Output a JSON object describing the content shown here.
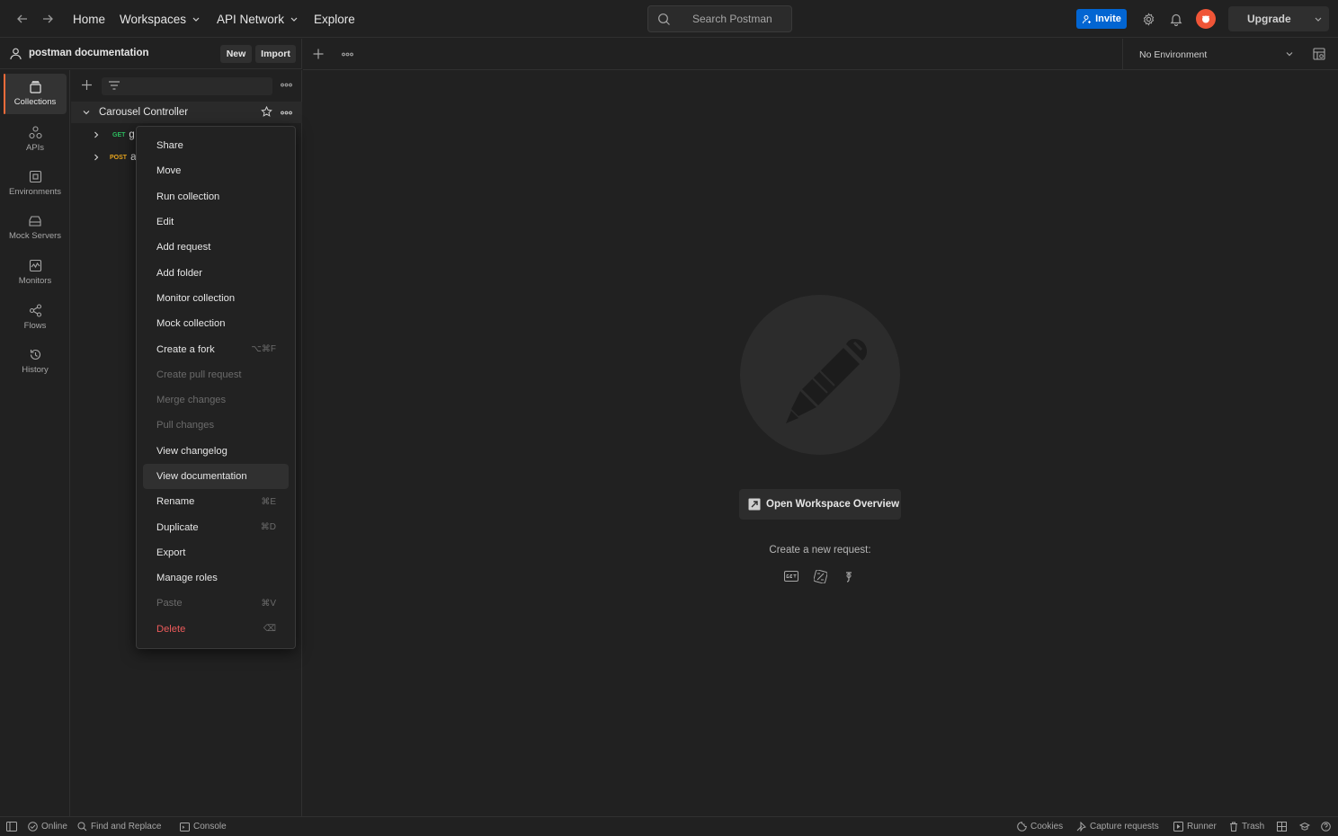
{
  "topbar": {
    "nav": {
      "home": "Home",
      "workspaces": "Workspaces",
      "api_network": "API Network",
      "explore": "Explore"
    },
    "search_placeholder": "Search Postman",
    "invite_label": "Invite",
    "upgrade_label": "Upgrade"
  },
  "workspace": {
    "name": "postman documentation",
    "new_label": "New",
    "import_label": "Import"
  },
  "rail": [
    {
      "label": "Collections",
      "icon": "collections-icon"
    },
    {
      "label": "APIs",
      "icon": "apis-icon"
    },
    {
      "label": "Environments",
      "icon": "environments-icon"
    },
    {
      "label": "Mock Servers",
      "icon": "mock-servers-icon"
    },
    {
      "label": "Monitors",
      "icon": "monitors-icon"
    },
    {
      "label": "Flows",
      "icon": "flows-icon"
    },
    {
      "label": "History",
      "icon": "history-icon"
    }
  ],
  "collection": {
    "name": "Carousel Controller",
    "requests": [
      {
        "method": "GET",
        "name": "g",
        "color": "#2dbb5f"
      },
      {
        "method": "POST",
        "name": "a",
        "color": "#e6a41e"
      }
    ]
  },
  "context_menu": [
    {
      "label": "Share",
      "shortcut": "",
      "state": "normal"
    },
    {
      "label": "Move",
      "shortcut": "",
      "state": "normal"
    },
    {
      "label": "Run collection",
      "shortcut": "",
      "state": "normal"
    },
    {
      "label": "Edit",
      "shortcut": "",
      "state": "normal"
    },
    {
      "label": "Add request",
      "shortcut": "",
      "state": "normal"
    },
    {
      "label": "Add folder",
      "shortcut": "",
      "state": "normal"
    },
    {
      "label": "Monitor collection",
      "shortcut": "",
      "state": "normal"
    },
    {
      "label": "Mock collection",
      "shortcut": "",
      "state": "normal"
    },
    {
      "label": "Create a fork",
      "shortcut": "⌥⌘F",
      "state": "normal"
    },
    {
      "label": "Create pull request",
      "shortcut": "",
      "state": "disabled"
    },
    {
      "label": "Merge changes",
      "shortcut": "",
      "state": "disabled"
    },
    {
      "label": "Pull changes",
      "shortcut": "",
      "state": "disabled"
    },
    {
      "label": "View changelog",
      "shortcut": "",
      "state": "normal"
    },
    {
      "label": "View documentation",
      "shortcut": "",
      "state": "hover"
    },
    {
      "label": "Rename",
      "shortcut": "⌘E",
      "state": "normal"
    },
    {
      "label": "Duplicate",
      "shortcut": "⌘D",
      "state": "normal"
    },
    {
      "label": "Export",
      "shortcut": "",
      "state": "normal"
    },
    {
      "label": "Manage roles",
      "shortcut": "",
      "state": "normal"
    },
    {
      "label": "Paste",
      "shortcut": "⌘V",
      "state": "disabled"
    },
    {
      "label": "Delete",
      "shortcut": "⌫",
      "state": "danger"
    }
  ],
  "environment": {
    "selected": "No Environment"
  },
  "main": {
    "overview_button": "Open Workspace Overview",
    "new_request_label": "Create a new request:"
  },
  "statusbar": {
    "online": "Online",
    "find_replace": "Find and Replace",
    "console": "Console",
    "cookies": "Cookies",
    "capture": "Capture requests",
    "runner": "Runner",
    "trash": "Trash"
  },
  "colors": {
    "accent": "#f26b3a",
    "invite_blue": "#0265d2",
    "danger": "#eb5a5a"
  }
}
